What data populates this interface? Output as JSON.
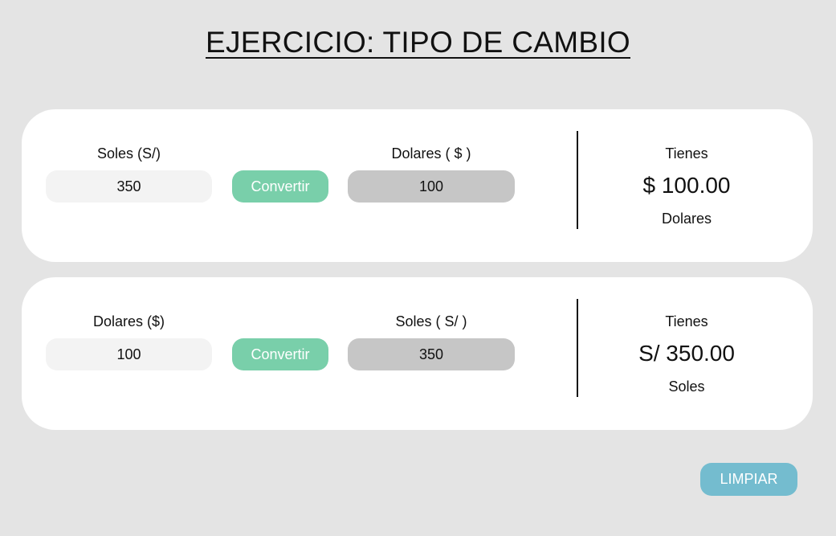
{
  "title": "EJERCICIO:  TIPO DE CAMBIO",
  "soles_to_dolares": {
    "input_label": "Soles (S/)",
    "input_value": "350",
    "convert_label": "Convertir",
    "output_label": "Dolares ( $ )",
    "output_value": "100",
    "result_prefix": "Tienes",
    "result_amount": "$ 100.00",
    "result_unit": "Dolares"
  },
  "dolares_to_soles": {
    "input_label": "Dolares ($)",
    "input_value": "100",
    "convert_label": "Convertir",
    "output_label": "Soles ( S/ )",
    "output_value": "350",
    "result_prefix": "Tienes",
    "result_amount": "S/ 350.00",
    "result_unit": "Soles"
  },
  "clear_label": "LIMPIAR",
  "colors": {
    "background": "#e4e4e4",
    "card": "#ffffff",
    "convert_button": "#79cfaa",
    "clear_button": "#74bccf",
    "input_field": "#f3f3f3",
    "output_field": "#c6c6c6"
  }
}
